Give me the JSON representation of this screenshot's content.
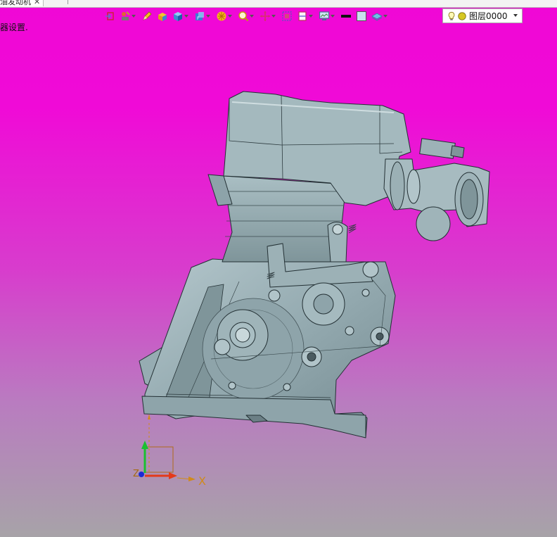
{
  "tab": {
    "title": "油发动机",
    "close_glyph": "✕"
  },
  "status_text": "器设置.",
  "layer": {
    "name": "图层0000"
  },
  "toolbar": {
    "icons": [
      "exit-sketch-icon",
      "sketch-tools-icon",
      "pencil-icon",
      "box-icon",
      "solid-cube-icon",
      "view-cube-icon",
      "render-style-icon",
      "zoom-icon",
      "move-icon",
      "frame-icon",
      "section-icon",
      "display-icon",
      "line-color-icon",
      "fill-color-icon",
      "layer-plane-icon"
    ]
  },
  "triad": {
    "x_label": "X",
    "z_label": "Z"
  },
  "colors": {
    "model": "#8fa6ac",
    "model_light": "#a6bcc2",
    "model_dark": "#5f7176",
    "axis_x": "#e43a1a",
    "axis_y": "#19c12f",
    "axis_z": "#1c2bd6",
    "axis_label": "#d08a1c"
  }
}
